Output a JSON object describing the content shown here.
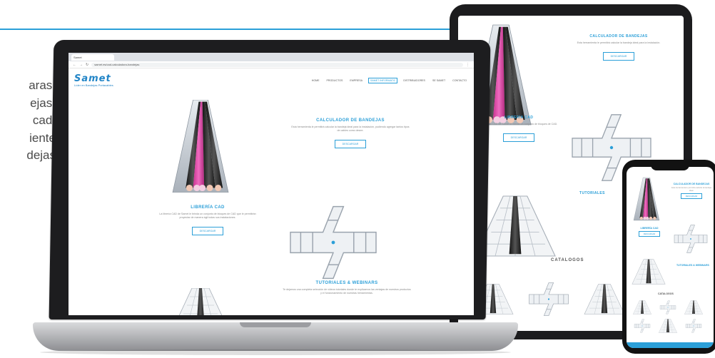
{
  "left_text": {
    "lines": [
      "aras,",
      "ejas.",
      "cad,",
      "iente",
      "dejas"
    ]
  },
  "laptop": {
    "tab_title": "Samet",
    "url": "samet.es/cad-calculadora-bandejas",
    "logo_word": "Samet",
    "logo_sub": "Líder en Bandejas Portacables",
    "nav": [
      "HOME",
      "PRODUCTOS",
      "EMPRESA",
      "SAMET INFORMATIC",
      "DISTRIBUIDORES",
      "SE SAMET",
      "CONTACTO"
    ],
    "calc": {
      "title": "CALCULADOR DE BANDEJAS",
      "body": "Esta herramienta le permitirá calcular la bandeja ideal para la instalación, pudiendo agregar tantos tipos de cables como desee.",
      "button": "DESCARGAR"
    },
    "cad": {
      "title": "LIBRERÍA CAD",
      "body": "La librería CAD de Samet le brinda un conjunto de bloques de CAD que le permitirán proyectar de manera ágil todas sus instalaciones.",
      "button": "DESCARGAR"
    },
    "tutorials": {
      "title": "TUTORIALES & WEBINARS",
      "body": "Te dejamos una completa selección de videos tutoriales donde te explicamos las ventajas de nuestros productos y el funcionamiento de nuestras herramientas."
    }
  },
  "tablet": {
    "calc": {
      "title": "CALCULADOR DE BANDEJAS",
      "body": "Esta herramienta le permitirá calcular la bandeja ideal para la instalación.",
      "button": "DESCARGAR"
    },
    "cad": {
      "title": "LIBRERÍA CAD",
      "body": "La librería CAD de Samet le brinda un conjunto de bloques de CAD.",
      "button": "DESCARGAR"
    },
    "tutorials": {
      "title": "TUTORIALES"
    },
    "catalogos": "CATALOGOS"
  },
  "phone": {
    "calc_title": "CALCULADOR DE BANDEJAS",
    "cad_title": "LIBRERÍA CAD",
    "tut_title": "TUTORIALES & WEBINARS",
    "catalogos": "CATALOGOS",
    "button": "DESCARGAR",
    "body": "Esta herramienta le permitirá calcular la bandeja ideal."
  },
  "colors": {
    "accent": "#2b9fd8",
    "cable_pink": "#e04aa8",
    "cable_dark": "#2a2a2a",
    "tray": "#c9cfd6"
  },
  "icons": [
    "back-icon",
    "forward-icon",
    "reload-icon",
    "menu-icon"
  ]
}
